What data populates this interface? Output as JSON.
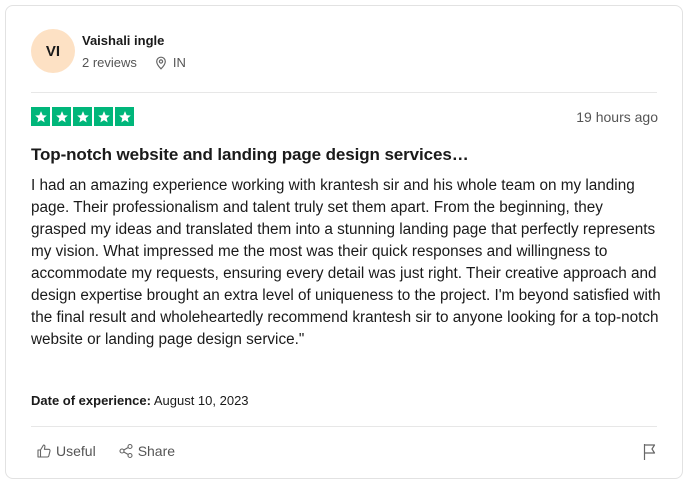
{
  "reviewer": {
    "initials": "VI",
    "name": "Vaishali ingle",
    "reviews_count": "2 reviews",
    "country": "IN",
    "avatar_color": "#fde1c4"
  },
  "rating": {
    "stars": 5,
    "max": 5,
    "color": "#00b67a"
  },
  "review": {
    "date": "19 hours ago",
    "title": "Top-notch website and landing page design services…",
    "body": "I had an amazing experience working with krantesh sir and his whole team on my landing page. Their professionalism and talent truly set them apart. From the beginning, they grasped my ideas and translated them into a stunning landing page that perfectly represents my vision. What impressed me the most was their quick responses and willingness to accommodate my requests, ensuring every detail was just right. Their creative approach and design expertise brought an extra level of uniqueness to the project. I'm beyond satisfied with the final result and wholeheartedly recommend krantesh sir to anyone looking for a top-notch website or landing page design service.\"",
    "experience_label": "Date of experience:",
    "experience_date": "August 10, 2023"
  },
  "actions": {
    "useful_label": "Useful",
    "share_label": "Share",
    "useful_icon": "thumbs-up-icon",
    "share_icon": "share-icon",
    "flag_icon": "flag-icon"
  }
}
